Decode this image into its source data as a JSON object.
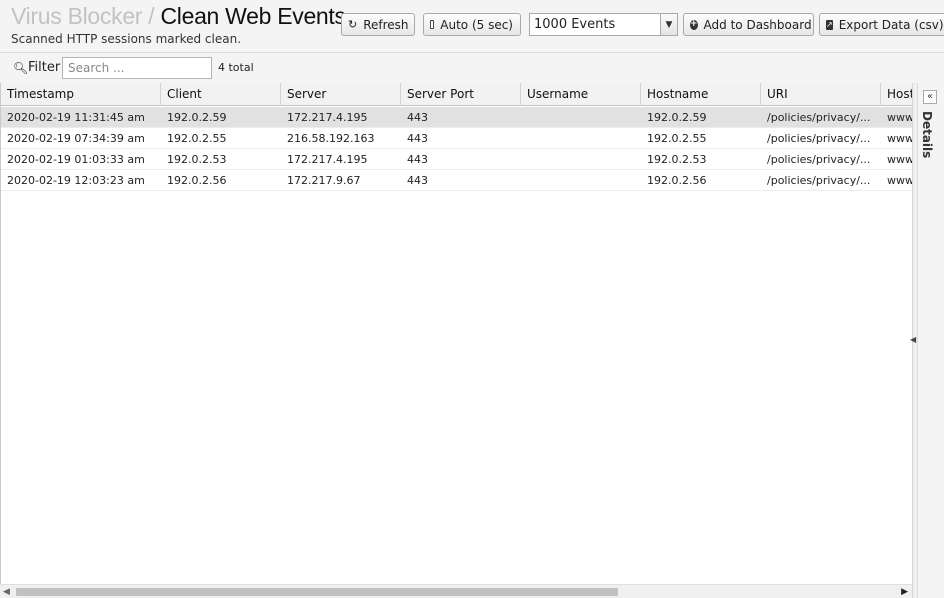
{
  "header": {
    "breadcrumb": "Virus Blocker",
    "separator": " / ",
    "title": "Clean Web Events",
    "subtitle": "Scanned HTTP sessions marked clean."
  },
  "toolbar": {
    "refresh_label": "Refresh",
    "auto_label": "Auto (5 sec)",
    "events_selected": "1000 Events",
    "add_dashboard_label": "Add to Dashboard",
    "export_label": "Export Data (csv)"
  },
  "filter": {
    "label": "Filter",
    "placeholder": "Search ...",
    "value": "",
    "total": "4 total"
  },
  "grid": {
    "columns": [
      "Timestamp",
      "Client",
      "Server",
      "Server Port",
      "Username",
      "Hostname",
      "URI",
      "Host"
    ],
    "rows": [
      {
        "timestamp": "2020-02-19 11:31:45 am",
        "client": "192.0.2.59",
        "server": "172.217.4.195",
        "port": "443",
        "username": "",
        "hostname": "192.0.2.59",
        "uri": "/policies/privacy/...",
        "host": "www.google.com"
      },
      {
        "timestamp": "2020-02-19 07:34:39 am",
        "client": "192.0.2.55",
        "server": "216.58.192.163",
        "port": "443",
        "username": "",
        "hostname": "192.0.2.55",
        "uri": "/policies/privacy/...",
        "host": "www.google.com"
      },
      {
        "timestamp": "2020-02-19 01:03:33 am",
        "client": "192.0.2.53",
        "server": "172.217.4.195",
        "port": "443",
        "username": "",
        "hostname": "192.0.2.53",
        "uri": "/policies/privacy/...",
        "host": "www.google.com"
      },
      {
        "timestamp": "2020-02-19 12:03:23 am",
        "client": "192.0.2.56",
        "server": "172.217.9.67",
        "port": "443",
        "username": "",
        "hostname": "192.0.2.56",
        "uri": "/policies/privacy/...",
        "host": "www.google.com"
      }
    ]
  },
  "details": {
    "label": "Details"
  }
}
